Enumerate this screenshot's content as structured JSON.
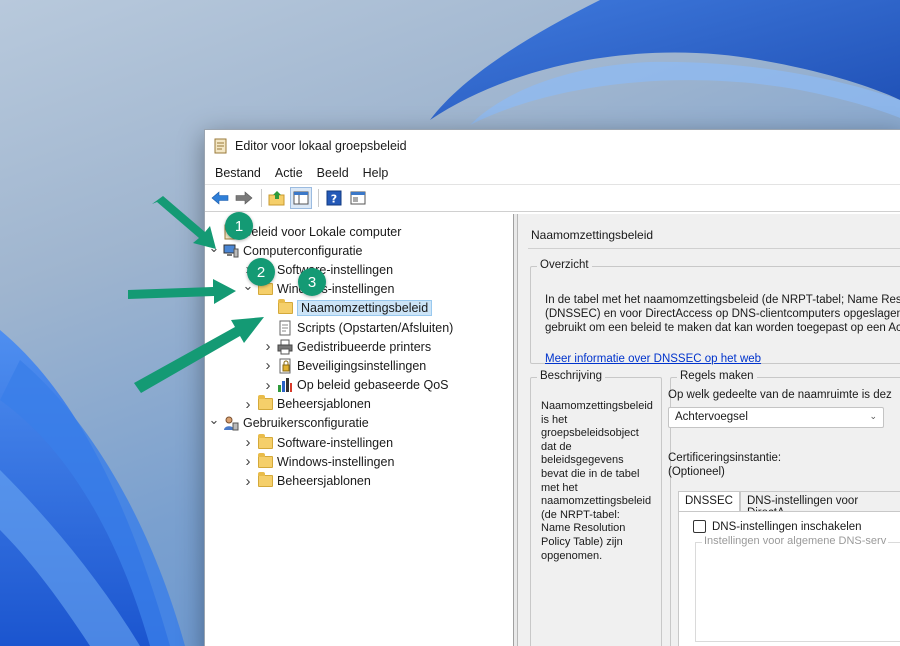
{
  "window": {
    "title": "Editor voor lokaal groepsbeleid"
  },
  "menu": [
    "Bestand",
    "Actie",
    "Beeld",
    "Help"
  ],
  "toolbar": [
    {
      "icon": "back-arrow-icon"
    },
    {
      "icon": "forward-arrow-icon"
    },
    {
      "icon": "up-folder-icon"
    },
    {
      "icon": "show-hide-tree-icon"
    },
    {
      "icon": "help-icon"
    },
    {
      "icon": "properties-icon"
    }
  ],
  "tree": [
    {
      "label": "Beleid voor Lokale computer",
      "level": 0,
      "chevron": "",
      "icon": "policy-document-icon"
    },
    {
      "label": "Computerconfiguratie",
      "level": 0,
      "chevron": "down",
      "icon": "computer-icon"
    },
    {
      "label": "Software-instellingen",
      "level": 1,
      "chevron": "right",
      "icon": "folder-icon"
    },
    {
      "label": "Windows-instellingen",
      "level": 1,
      "chevron": "down",
      "icon": "folder-icon"
    },
    {
      "label": "Naamomzettingsbeleid",
      "level": 2,
      "chevron": "",
      "icon": "folder-icon",
      "selected": true
    },
    {
      "label": "Scripts (Opstarten/Afsluiten)",
      "level": 2,
      "chevron": "",
      "icon": "script-icon"
    },
    {
      "label": "Gedistribueerde printers",
      "level": 2,
      "chevron": "right",
      "icon": "printer-icon"
    },
    {
      "label": "Beveiligingsinstellingen",
      "level": 2,
      "chevron": "right",
      "icon": "security-icon"
    },
    {
      "label": "Op beleid gebaseerde QoS",
      "level": 2,
      "chevron": "right",
      "icon": "qos-chart-icon"
    },
    {
      "label": "Beheersjablonen",
      "level": 1,
      "chevron": "right",
      "icon": "folder-icon"
    },
    {
      "label": "Gebruikersconfiguratie",
      "level": 0,
      "chevron": "down",
      "icon": "user-icon"
    },
    {
      "label": "Software-instellingen",
      "level": 1,
      "chevron": "right",
      "icon": "folder-icon"
    },
    {
      "label": "Windows-instellingen",
      "level": 1,
      "chevron": "right",
      "icon": "folder-icon"
    },
    {
      "label": "Beheersjablonen",
      "level": 1,
      "chevron": "right",
      "icon": "folder-icon"
    }
  ],
  "right": {
    "header": "Naamomzettingsbeleid",
    "overview": {
      "legend": "Overzicht",
      "lines": [
        "In de tabel met het naamomzettingsbeleid (de NRPT-tabel; Name Reso",
        "(DNSSEC) en voor DirectAccess op DNS-clientcomputers opgeslagen.",
        "gebruikt om een beleid te maken dat kan worden toegepast op een Ac"
      ],
      "link": "Meer informatie over DNSSEC op het web"
    },
    "description": {
      "legend": "Beschrijving",
      "text": "Naamomzettingsbeleid is het groepsbeleidsobject dat de beleidsgegevens bevat die in de tabel met het naamomzettingsbeleid (de NRPT-tabel: Name Resolution Policy Table) zijn opgenomen."
    },
    "rules": {
      "legend": "Regels maken",
      "question": "Op welk gedeelte van de naamruimte is dez",
      "select_value": "Achtervoegsel",
      "cert_label": "Certificeringsinstantie:",
      "cert_optional": "(Optioneel)",
      "tabs": [
        "DNSSEC",
        "DNS-instellingen voor DirectA"
      ],
      "checkbox_label": "DNS-instellingen inschakelen",
      "inner_legend": "Instellingen voor algemene DNS-serv"
    }
  },
  "annotations": [
    "1",
    "2",
    "3"
  ],
  "colors": {
    "annotation": "#149a74",
    "selection": "#cce4f7",
    "link": "#0033cc"
  }
}
